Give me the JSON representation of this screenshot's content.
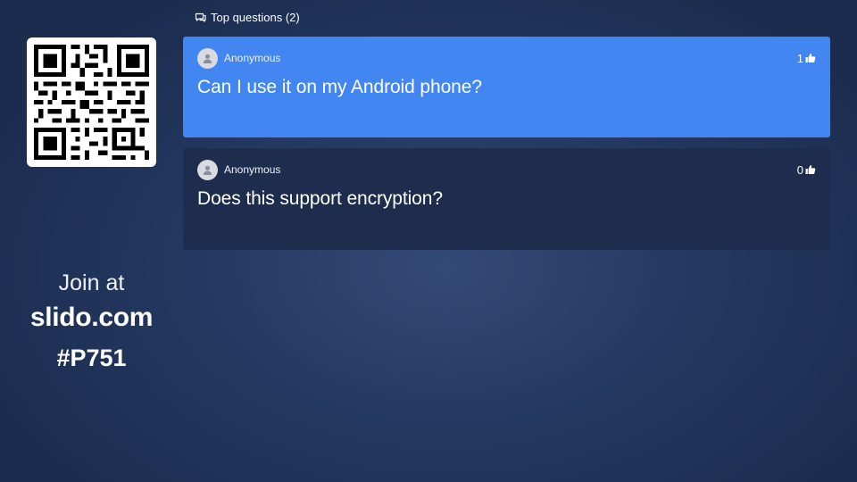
{
  "join": {
    "prefix": "Join at",
    "domain": "slido.com",
    "code": "#P751"
  },
  "qr": {
    "icon": "qr-code-icon"
  },
  "section": {
    "title": "Top questions (2)",
    "icon": "comments-icon"
  },
  "questions": [
    {
      "author": "Anonymous",
      "votes": "1",
      "text": "Can I use it on my Android phone?",
      "highlighted": true,
      "color": "#4287f1"
    },
    {
      "author": "Anonymous",
      "votes": "0",
      "text": "Does this support encryption?",
      "highlighted": false,
      "color": "#1e2d4d"
    }
  ],
  "icons": {
    "avatar": "user-avatar-icon",
    "like": "thumbs-up-icon"
  }
}
